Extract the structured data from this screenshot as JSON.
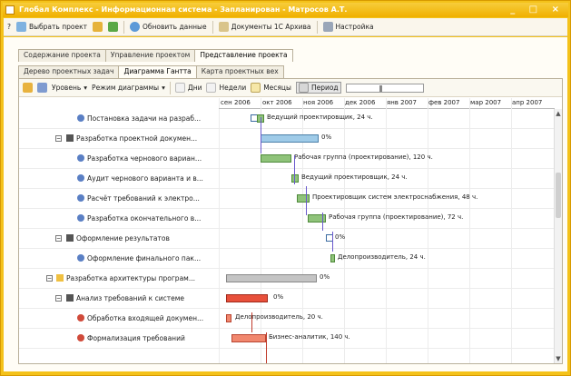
{
  "window": {
    "title": "Глобал Комплекс - Информационная система - Запланирован - Матросов А.Т.",
    "controls": "_ □ ×"
  },
  "toolbar": {
    "help": "?",
    "select_project": "Выбрать проект",
    "refresh": "Обновить данные",
    "documents": "Документы 1С Архива",
    "settings": "Настройка"
  },
  "tabs_main": [
    "Содержание проекта",
    "Управление проектом",
    "Представление проекта"
  ],
  "tabs_sub": [
    "Дерево проектных задач",
    "Диаграмма Гантта",
    "Карта проектных вех"
  ],
  "gantt_toolbar": {
    "level": "Уровень",
    "mode": "Режим диаграммы",
    "days": "Дни",
    "weeks": "Недели",
    "months": "Месяцы",
    "period": "Период"
  },
  "months": [
    "сен 2006",
    "окт 2006",
    "ноя 2006",
    "дек 2006",
    "янв 2007",
    "фев 2007",
    "мар 2007",
    "апр 2007"
  ],
  "rows": [
    {
      "name": "Постановка задачи на разраб...",
      "label": "Ведущий проектировщик, 24 ч."
    },
    {
      "name": "Разработка проектной докумен...",
      "label": "0%"
    },
    {
      "name": "Разработка чернового вариан...",
      "label": "Рабочая группа (проектирование), 120 ч."
    },
    {
      "name": "Аудит чернового варианта и в...",
      "label": "Ведущий проектировщик, 24 ч."
    },
    {
      "name": "Расчёт требований к электро...",
      "label": "Проектировщик систем электроснабжения, 48 ч."
    },
    {
      "name": "Разработка окончательного в...",
      "label": "Рабочая группа (проектирование), 72 ч."
    },
    {
      "name": "Оформление результатов",
      "label": "0%"
    },
    {
      "name": "Оформление финального пак...",
      "label": "Делопроизводитель, 24 ч."
    },
    {
      "name": "Разработка архитектуры програм...",
      "label": "0%"
    },
    {
      "name": "Анализ требований к системе",
      "label": "0%"
    },
    {
      "name": "Обработка входящей докумен...",
      "label": "Делопроизводитель, 20 ч."
    },
    {
      "name": "Формализация требований",
      "label": "Бизнес-аналитик, 140 ч."
    }
  ],
  "colors": {
    "title_bar": "#f0b000",
    "task_bar": "#8fc37a",
    "summary_bar": "#9fcbe8",
    "project_bar": "#c4c4c4",
    "critical_bar": "#e8503b"
  }
}
